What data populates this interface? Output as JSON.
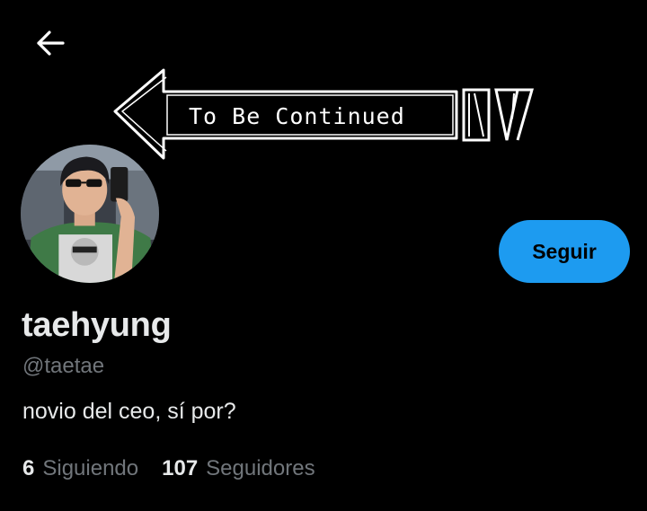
{
  "header": {
    "back_icon": "arrow-left-icon",
    "banner_text": "To Be Continued"
  },
  "profile": {
    "display_name": "taehyung",
    "handle": "@taetae",
    "bio": "novio del ceo, sí por?",
    "follow_label": "Seguir",
    "following_count": "6",
    "following_label": "Siguiendo",
    "followers_count": "107",
    "followers_label": "Seguidores"
  },
  "colors": {
    "background": "#000000",
    "accent": "#1d9bf0",
    "primary_text": "#e7e9ea",
    "secondary_text": "#71767b"
  }
}
